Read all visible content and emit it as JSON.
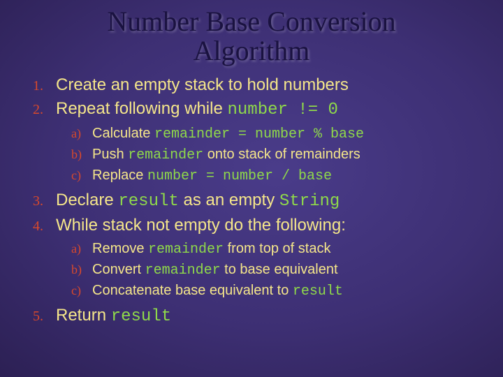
{
  "title_line1": "Number Base Conversion",
  "title_line2": "Algorithm",
  "items": {
    "n1": "1.",
    "t1a": "Create an empty stack to hold numbers",
    "n2": "2.",
    "t2a": "Repeat following while ",
    "t2code": "number != 0",
    "s2a_n": "a)",
    "s2a_t1": "Calculate ",
    "s2a_c": "remainder = number % base",
    "s2b_n": "b)",
    "s2b_t1": "Push ",
    "s2b_c": "remainder",
    "s2b_t2": " onto stack of remainders",
    "s2c_n": "c)",
    "s2c_t1": "Replace ",
    "s2c_c": "number = number / base",
    "n3": "3.",
    "t3a": "Declare ",
    "t3c1": "result",
    "t3b": " as an empty ",
    "t3c2": "String",
    "n4": "4.",
    "t4a": "While stack not empty do the following:",
    "s4a_n": "a)",
    "s4a_t1": "Remove ",
    "s4a_c": "remainder",
    "s4a_t2": " from top of stack",
    "s4b_n": "b)",
    "s4b_t1": "Convert ",
    "s4b_c": "remainder",
    "s4b_t2": " to base equivalent",
    "s4c_n": "c)",
    "s4c_t1": "Concatenate base equivalent to ",
    "s4c_c": "result",
    "n5": "5.",
    "t5a": "Return ",
    "t5c": "result"
  }
}
